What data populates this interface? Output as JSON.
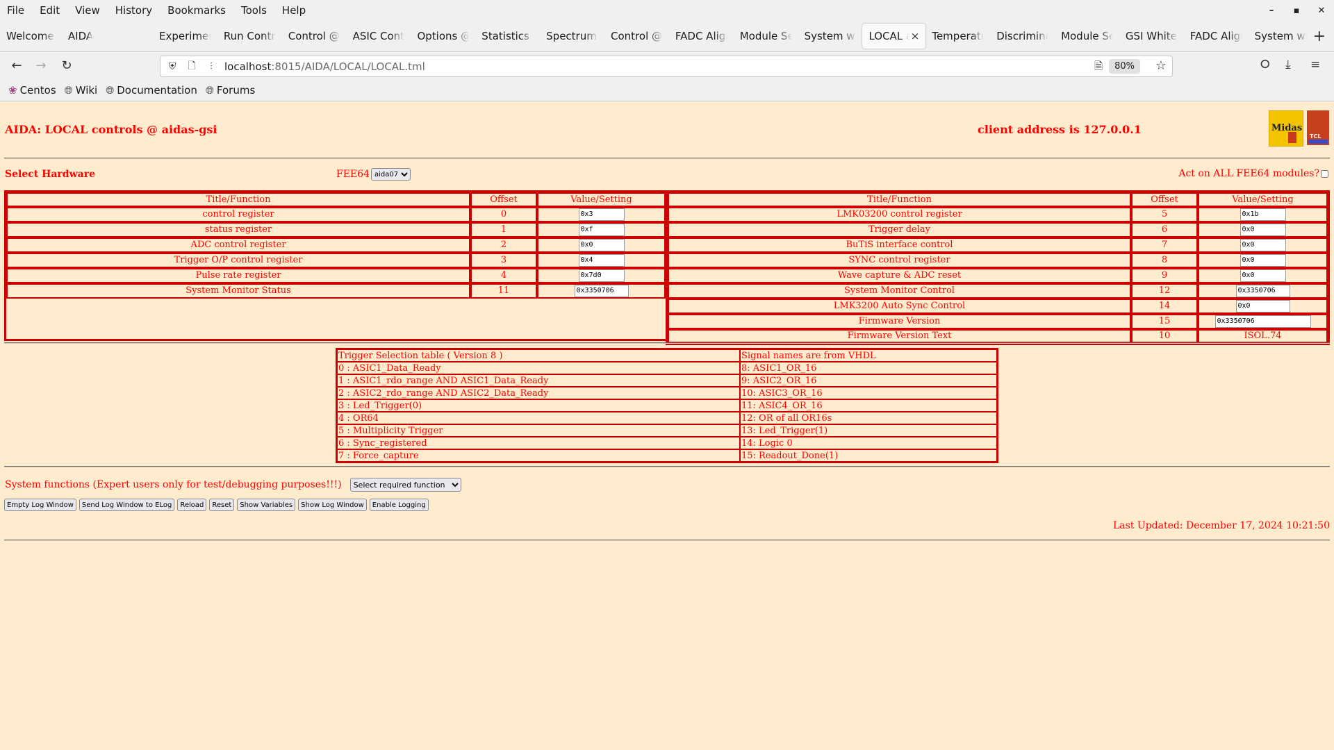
{
  "browser": {
    "menu": [
      "File",
      "Edit",
      "View",
      "History",
      "Bookmarks",
      "Tools",
      "Help"
    ],
    "tabs": [
      {
        "label": "Welcome to",
        "active": false
      },
      {
        "label": "AIDA",
        "active": false
      },
      {
        "label": "Experiment",
        "active": false
      },
      {
        "label": "Run Control",
        "active": false
      },
      {
        "label": "Control @ a",
        "active": false
      },
      {
        "label": "ASIC Contr",
        "active": false
      },
      {
        "label": "Options @",
        "active": false
      },
      {
        "label": "Statistics @",
        "active": false
      },
      {
        "label": "Spectrum B",
        "active": false
      },
      {
        "label": "Control @ a",
        "active": false
      },
      {
        "label": "FADC Align",
        "active": false
      },
      {
        "label": "Module Set",
        "active": false
      },
      {
        "label": "System wid",
        "active": false
      },
      {
        "label": "LOCAL ar",
        "active": true
      },
      {
        "label": "Temperatur",
        "active": false
      },
      {
        "label": "Discriminat",
        "active": false
      },
      {
        "label": "Module Set",
        "active": false
      },
      {
        "label": "GSI White R",
        "active": false
      },
      {
        "label": "FADC Align",
        "active": false
      },
      {
        "label": "System wid",
        "active": false
      }
    ],
    "url_host": "localhost",
    "url_rest": ":8015/AIDA/LOCAL/LOCAL.tml",
    "zoom": "80%",
    "bookmarks": [
      {
        "label": "Centos",
        "icon": "centos-icon"
      },
      {
        "label": "Wiki",
        "icon": "globe-icon"
      },
      {
        "label": "Documentation",
        "icon": "globe-icon"
      },
      {
        "label": "Forums",
        "icon": "globe-icon"
      }
    ]
  },
  "page": {
    "title": "AIDA: LOCAL controls @ aidas-gsi",
    "client_address": "client address is 127.0.0.1",
    "select_hardware": "Select Hardware",
    "fee_label": "FEE64",
    "fee_selected": "aida07",
    "act_all_label": "Act on ALL FEE64 modules?",
    "act_all_checked": false,
    "headers": {
      "title": "Title/Function",
      "offset": "Offset",
      "value": "Value/Setting"
    },
    "left_registers": [
      {
        "title": "control register",
        "offset": "0",
        "value": "0x3"
      },
      {
        "title": "status register",
        "offset": "1",
        "value": "0xf"
      },
      {
        "title": "ADC control register",
        "offset": "2",
        "value": "0x0"
      },
      {
        "title": "Trigger O/P control register",
        "offset": "3",
        "value": "0x4"
      },
      {
        "title": "Pulse rate register",
        "offset": "4",
        "value": "0x7d0"
      },
      {
        "title": "System Monitor Status",
        "offset": "11",
        "value": "0x3350706"
      }
    ],
    "right_registers": [
      {
        "title": "LMK03200 control register",
        "offset": "5",
        "value": "0x1b"
      },
      {
        "title": "Trigger delay",
        "offset": "6",
        "value": "0x0"
      },
      {
        "title": "BuTiS interface control",
        "offset": "7",
        "value": "0x0"
      },
      {
        "title": "SYNC control register",
        "offset": "8",
        "value": "0x0"
      },
      {
        "title": "Wave capture & ADC reset",
        "offset": "9",
        "value": "0x0"
      },
      {
        "title": "System Monitor Control",
        "offset": "12",
        "value": "0x3350706"
      },
      {
        "title": "LMK3200 Auto Sync Control",
        "offset": "14",
        "value": "0x0"
      },
      {
        "title": "Firmware Version",
        "offset": "15",
        "value": "0x3350706"
      },
      {
        "title": "Firmware Version Text",
        "offset": "10",
        "value": "ISOL.74"
      }
    ],
    "trigger_table": {
      "header_left": "Trigger Selection table ( Version 8 )",
      "header_right": "Signal names are from VHDL",
      "left": [
        "0 : ASIC1_Data_Ready",
        "1 : ASIC1_rdo_range AND ASIC1_Data_Ready",
        "2 : ASIC2_rdo_range AND ASIC2_Data_Ready",
        "3 : Led_Trigger(0)",
        "4 : OR64",
        "5 : Multiplicity Trigger",
        "6 : Sync_registered",
        "7 : Force_capture"
      ],
      "right": [
        "8: ASIC1_OR_16",
        "9: ASIC2_OR_16",
        "10: ASIC3_OR_16",
        "11: ASIC4_OR_16",
        "12: OR of all OR16s",
        "13: Led_Trigger(1)",
        "14: Logic 0",
        "15: Readout_Done(1)"
      ]
    },
    "system_functions_label": "System functions (Expert users only for test/debugging purposes!!!)",
    "system_function_select": "Select required function",
    "buttons": [
      "Empty Log Window",
      "Send Log Window to ELog",
      "Reload",
      "Reset",
      "Show Variables",
      "Show Log Window",
      "Enable Logging"
    ],
    "last_updated": "Last Updated: December 17, 2024 10:21:50"
  },
  "colors": {
    "page_bg": "#ffebcd",
    "accent_red": "#ff0000",
    "border_red": "#cc0000"
  }
}
